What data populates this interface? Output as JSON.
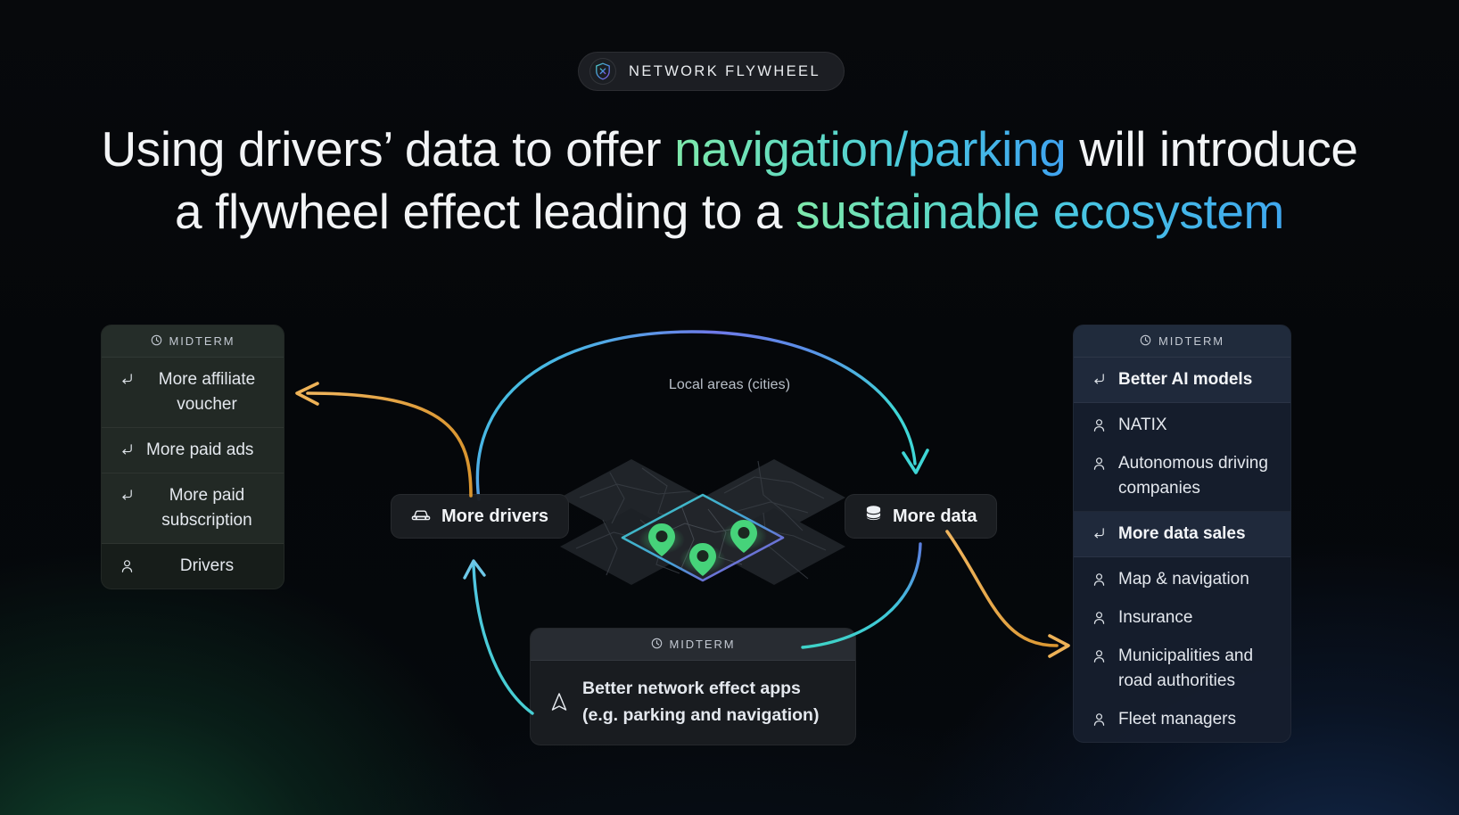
{
  "badge": {
    "icon": "shield-logo-icon",
    "label": "NETWORK FLYWHEEL"
  },
  "headline": {
    "line1_a": "Using drivers’ data to offer ",
    "line1_highlight": "navigation/parking",
    "line1_b": " will introduce",
    "line2_a": "a flywheel effect leading to a ",
    "line2_highlight": "sustainable ecosystem"
  },
  "center": {
    "label": "Local areas (cities)",
    "art": "isometric-city-map-tiles",
    "pins": 3
  },
  "nodes": {
    "drivers": {
      "label": "More drivers",
      "icon": "car-icon"
    },
    "data": {
      "label": "More data",
      "icon": "database-icon"
    }
  },
  "left_card": {
    "header": {
      "label": "MIDTERM",
      "icon": "clock-icon"
    },
    "rows": [
      {
        "icon": "branch-arrow-icon",
        "label": "More affiliate voucher",
        "type": "branch",
        "align": "center"
      },
      {
        "icon": "branch-arrow-icon",
        "label": "More paid ads",
        "type": "branch",
        "align": "left"
      },
      {
        "icon": "branch-arrow-icon",
        "label": "More paid subscription",
        "type": "branch",
        "align": "center"
      },
      {
        "icon": "person-icon",
        "label": "Drivers",
        "type": "person",
        "align": "center"
      }
    ]
  },
  "right_card": {
    "header": {
      "label": "MIDTERM",
      "icon": "clock-icon"
    },
    "rows": [
      {
        "icon": "branch-arrow-icon",
        "label": "Better AI models",
        "type": "branch",
        "bold": true
      },
      {
        "icon": "person-icon",
        "label": "NATIX",
        "type": "person",
        "bold": false
      },
      {
        "icon": "person-icon",
        "label": "Autonomous driving companies",
        "type": "person",
        "bold": false
      },
      {
        "icon": "branch-arrow-icon",
        "label": "More data sales",
        "type": "branch",
        "bold": true
      },
      {
        "icon": "person-icon",
        "label": "Map & navigation",
        "type": "person",
        "bold": false
      },
      {
        "icon": "person-icon",
        "label": "Insurance",
        "type": "person",
        "bold": false
      },
      {
        "icon": "person-icon",
        "label": "Municipalities and road authorities",
        "type": "person",
        "bold": false
      },
      {
        "icon": "person-icon",
        "label": "Fleet managers",
        "type": "person",
        "bold": false
      }
    ]
  },
  "bottom_card": {
    "header": {
      "label": "MIDTERM",
      "icon": "clock-icon"
    },
    "icon": "navigation-arrow-icon",
    "line1": "Better network effect apps",
    "line2": "(e.g. parking and navigation)"
  },
  "colors": {
    "accent_green": "#7fe9ab",
    "accent_cyan": "#3fd3d0",
    "accent_blue": "#3fa2f0",
    "accent_purple": "#7b5fe0",
    "accent_orange": "#e8a849",
    "pin_green": "#4ade80",
    "background": "#05070a"
  }
}
